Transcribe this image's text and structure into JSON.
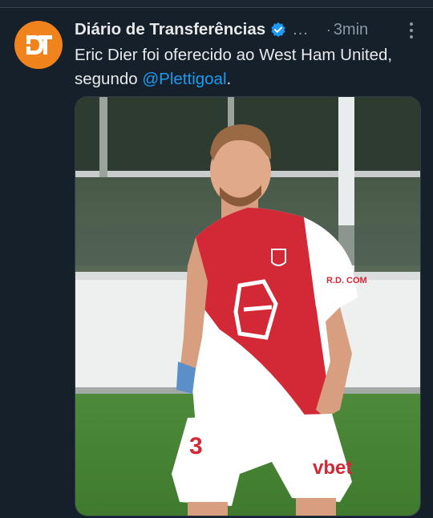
{
  "tweet": {
    "author_name": "Diário de Transferências",
    "verified_icon": "verified-badge-icon",
    "handle_truncated": "...",
    "separator": "·",
    "time": "3min",
    "text_before": "Eric Dier foi oferecido ao West Ham United, segundo ",
    "mention": "@Plettigoal",
    "text_after": ".",
    "avatar_icon": "dt-logo-icon",
    "more_icon": "more-options-icon",
    "media": {
      "shirt_text": "R.D. COM",
      "shirt_sponsor": "vbet",
      "shorts_number": "3"
    }
  },
  "colors": {
    "background": "#15202b",
    "accent": "#1d9bf0",
    "avatar": "#f0831c",
    "secondary_text": "#8b98a5"
  }
}
